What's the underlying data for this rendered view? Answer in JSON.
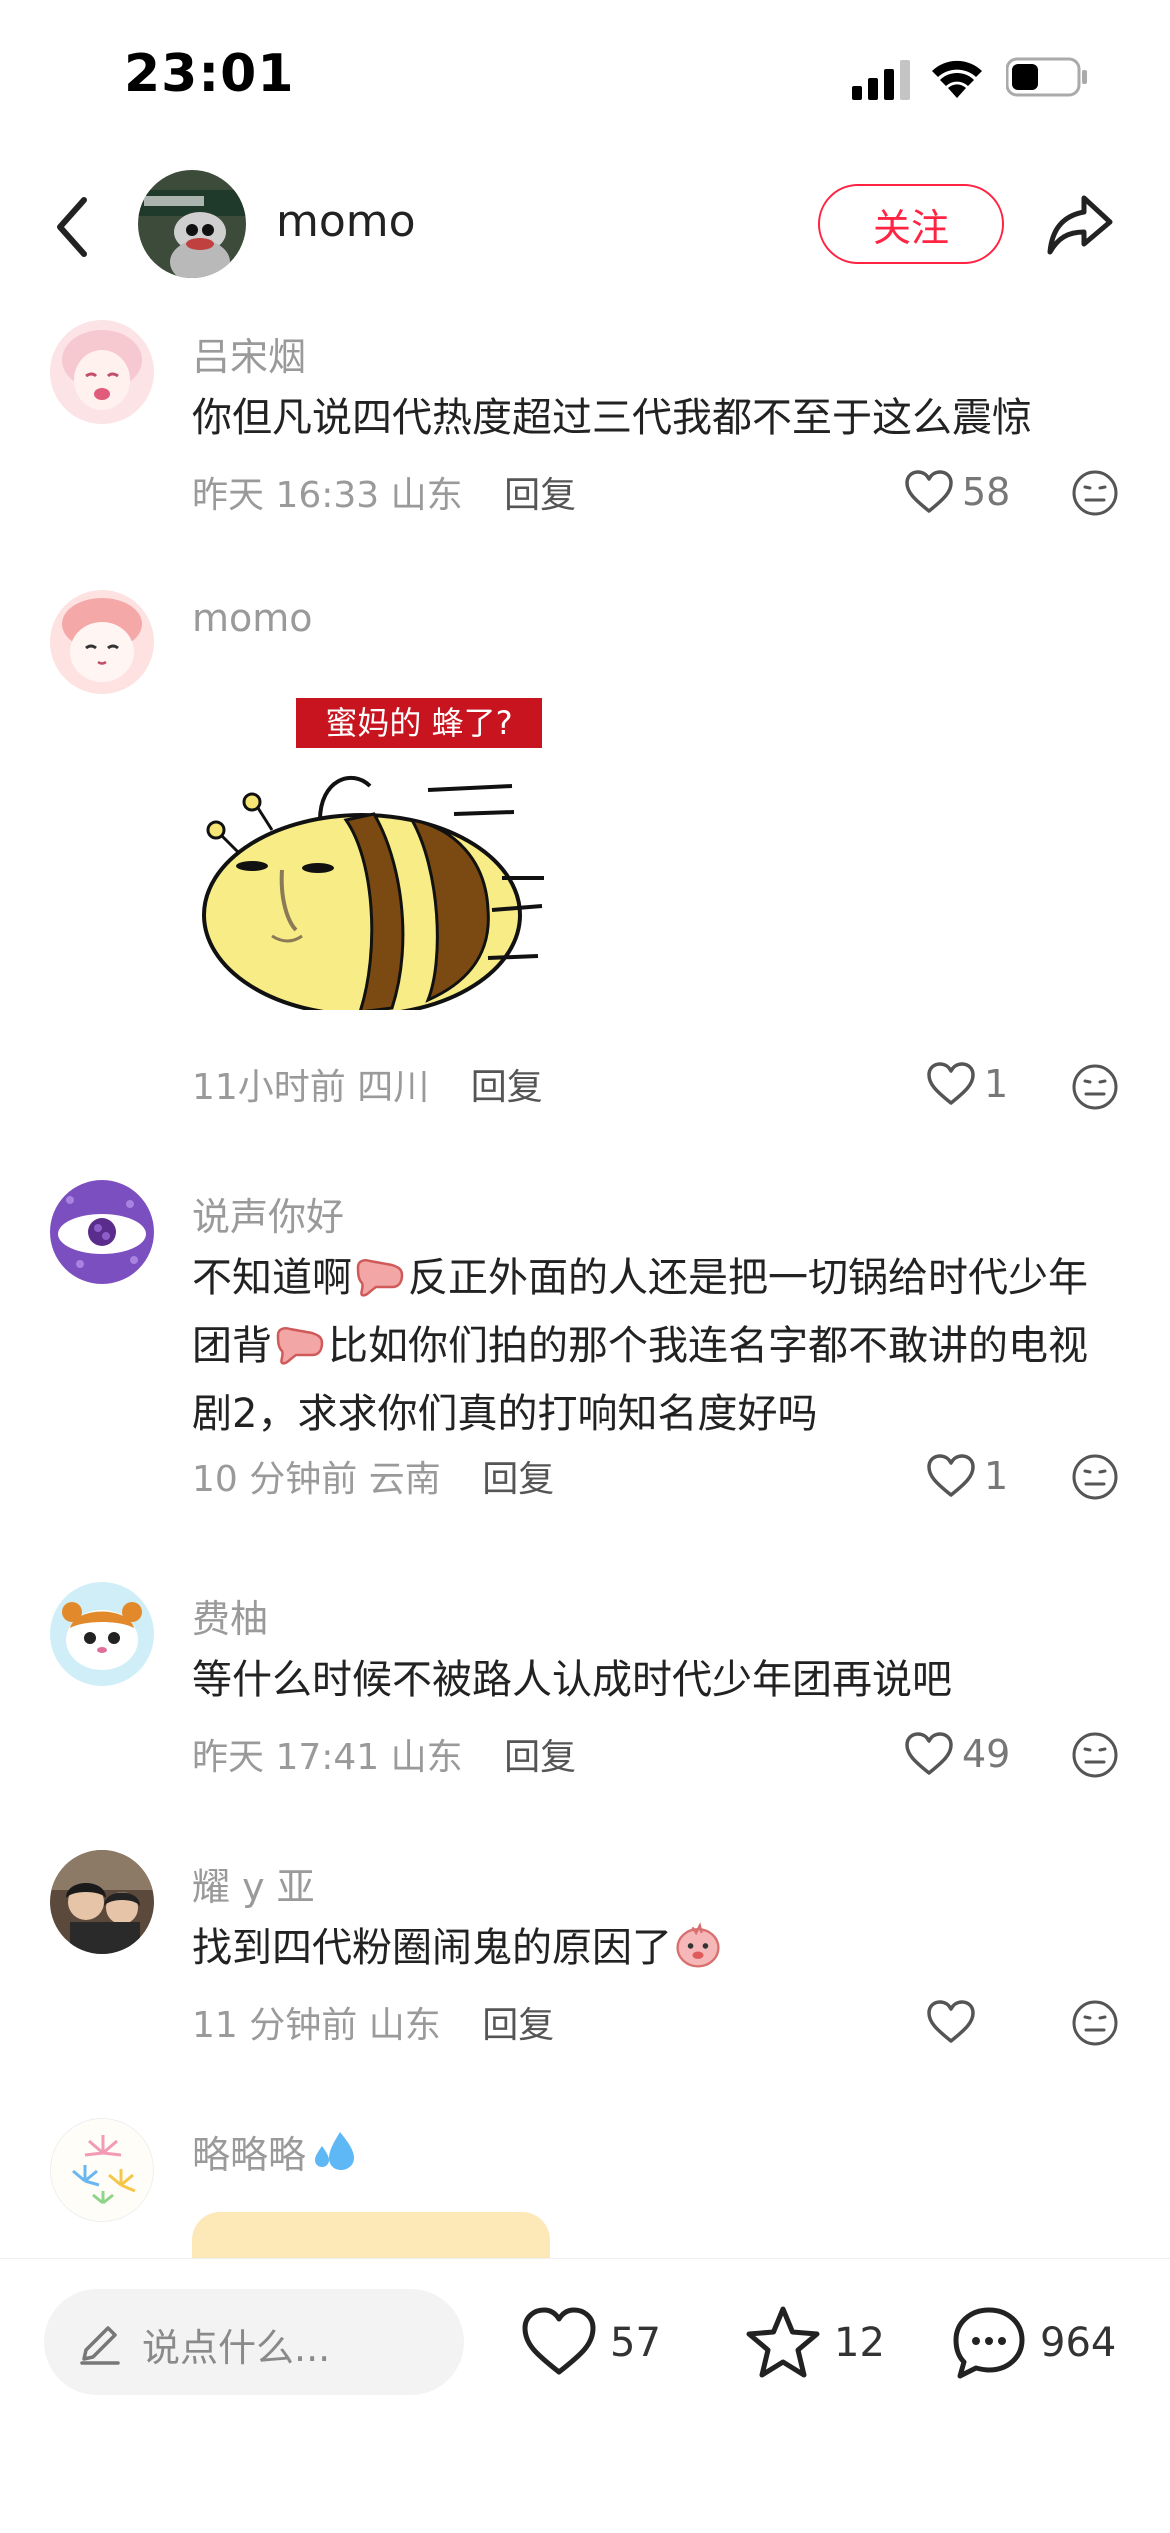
{
  "status_bar": {
    "time": "23:01"
  },
  "header": {
    "username": "momo",
    "follow_label": "关注"
  },
  "comments": [
    {
      "name": "吕宋烟",
      "text": "你但凡说四代热度超过三代我都不至于这么震惊",
      "time": "昨天 16:33",
      "location": "山东",
      "reply": "回复",
      "likes": "58"
    },
    {
      "name": "momo",
      "sticker_caption": "蜜妈的 蜂了?",
      "time": "11小时前",
      "location": "四川",
      "reply": "回复",
      "likes": "1"
    },
    {
      "name": "说声你好",
      "text_parts": [
        "不知道啊",
        "反正外面的人还是把一切锅给时代少年团背",
        "比如你们拍的那个我连名字都不敢讲的电视剧2，求求你们真的打响知名度好吗"
      ],
      "time": "10 分钟前",
      "location": "云南",
      "reply": "回复",
      "likes": "1"
    },
    {
      "name": "费柚",
      "text": "等什么时候不被路人认成时代少年团再说吧",
      "time": "昨天 17:41",
      "location": "山东",
      "reply": "回复",
      "likes": "49"
    },
    {
      "name": "耀 y 亚",
      "text": "找到四代粉圈闹鬼的原因了",
      "time": "11 分钟前",
      "location": "山东",
      "reply": "回复",
      "likes": ""
    },
    {
      "name": "略略略"
    }
  ],
  "bottom_bar": {
    "placeholder": "说点什么...",
    "likes": "57",
    "stars": "12",
    "comments": "964"
  },
  "colors": {
    "accent": "#ff2442",
    "secondary_text": "#9a9a9a"
  }
}
